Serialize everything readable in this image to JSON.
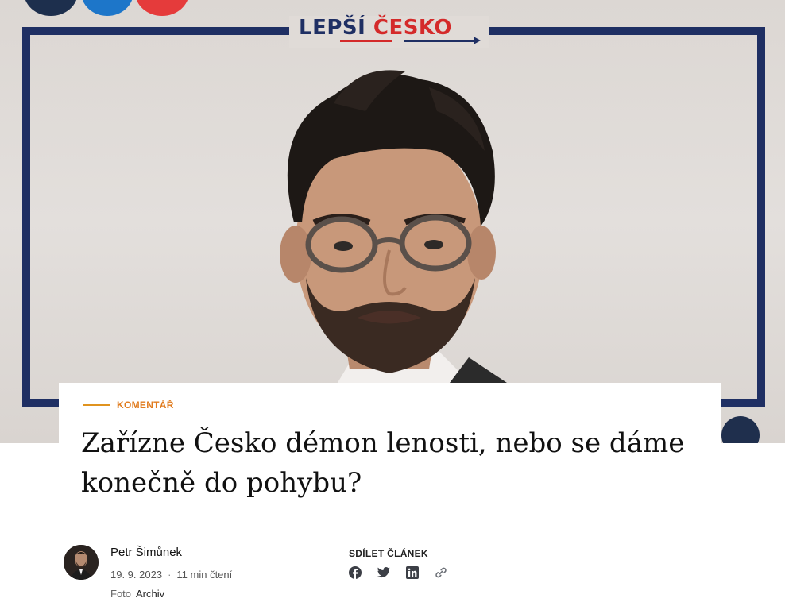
{
  "hero": {
    "logo": {
      "word1": "LEPŠÍ",
      "word2": "ČESKO"
    },
    "colors": {
      "frame": "#1f2f63",
      "accent_red": "#d42a2a"
    }
  },
  "article": {
    "category": "KOMENTÁŘ",
    "title": "Zařízne Česko démon lenosti, nebo se dáme konečně do pohybu?"
  },
  "author": {
    "name": "Petr Šimůnek",
    "date": "19. 9. 2023",
    "separator": "·",
    "read_time": "11 min čtení",
    "photo_label": "Foto",
    "photo_credit": "Archiv"
  },
  "share": {
    "label": "SDÍLET ČLÁNEK",
    "icons": [
      "facebook-icon",
      "twitter-icon",
      "linkedin-icon",
      "link-icon"
    ]
  },
  "colors": {
    "kicker": "#e07b1e",
    "text": "#111111"
  }
}
